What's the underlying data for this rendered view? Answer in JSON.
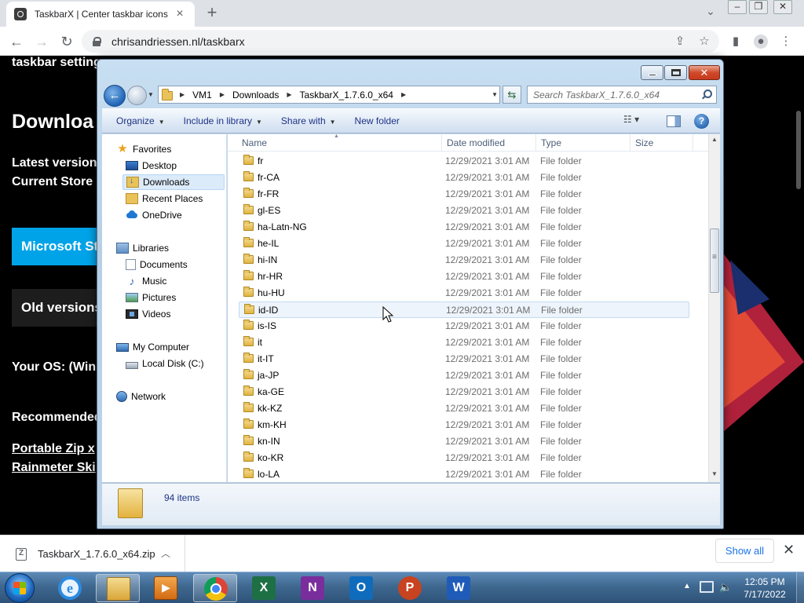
{
  "browser": {
    "tab_title": "TaskbarX | Center taskbar icons",
    "new_tab": "+",
    "url": "chrisandriessen.nl/taskbarx"
  },
  "webpage": {
    "line_top": "taskbar setting",
    "heading": "Downloa",
    "latest": "Latest version",
    "current": "Current Store ",
    "store_button": "Microsoft Sto",
    "old_button": "Old versions",
    "your_os": "Your OS: (Win",
    "recommended": "Recommended",
    "link1": "Portable Zip x",
    "link2": "Rainmeter Ski",
    "colors": {
      "store_button_bg": "#00a3e8",
      "old_button_bg": "#1d1d1d"
    }
  },
  "explorer": {
    "breadcrumbs": [
      "VM1",
      "Downloads",
      "TaskbarX_1.7.6.0_x64"
    ],
    "search_placeholder": "Search TaskbarX_1.7.6.0_x64",
    "toolbar": {
      "organize": "Organize",
      "include": "Include in library",
      "share": "Share with",
      "new_folder": "New folder"
    },
    "nav": {
      "favorites": "Favorites",
      "desktop": "Desktop",
      "downloads": "Downloads",
      "recent": "Recent Places",
      "onedrive": "OneDrive",
      "libraries": "Libraries",
      "documents": "Documents",
      "music": "Music",
      "pictures": "Pictures",
      "videos": "Videos",
      "computer": "My Computer",
      "local_disk": "Local Disk (C:)",
      "network": "Network"
    },
    "columns": {
      "name": "Name",
      "date": "Date modified",
      "type": "Type",
      "size": "Size"
    },
    "rows": [
      {
        "name": "fr",
        "date": "12/29/2021 3:01 AM",
        "type": "File folder"
      },
      {
        "name": "fr-CA",
        "date": "12/29/2021 3:01 AM",
        "type": "File folder"
      },
      {
        "name": "fr-FR",
        "date": "12/29/2021 3:01 AM",
        "type": "File folder"
      },
      {
        "name": "gl-ES",
        "date": "12/29/2021 3:01 AM",
        "type": "File folder"
      },
      {
        "name": "ha-Latn-NG",
        "date": "12/29/2021 3:01 AM",
        "type": "File folder"
      },
      {
        "name": "he-IL",
        "date": "12/29/2021 3:01 AM",
        "type": "File folder"
      },
      {
        "name": "hi-IN",
        "date": "12/29/2021 3:01 AM",
        "type": "File folder"
      },
      {
        "name": "hr-HR",
        "date": "12/29/2021 3:01 AM",
        "type": "File folder"
      },
      {
        "name": "hu-HU",
        "date": "12/29/2021 3:01 AM",
        "type": "File folder"
      },
      {
        "name": "id-ID",
        "date": "12/29/2021 3:01 AM",
        "type": "File folder"
      },
      {
        "name": "is-IS",
        "date": "12/29/2021 3:01 AM",
        "type": "File folder"
      },
      {
        "name": "it",
        "date": "12/29/2021 3:01 AM",
        "type": "File folder"
      },
      {
        "name": "it-IT",
        "date": "12/29/2021 3:01 AM",
        "type": "File folder"
      },
      {
        "name": "ja-JP",
        "date": "12/29/2021 3:01 AM",
        "type": "File folder"
      },
      {
        "name": "ka-GE",
        "date": "12/29/2021 3:01 AM",
        "type": "File folder"
      },
      {
        "name": "kk-KZ",
        "date": "12/29/2021 3:01 AM",
        "type": "File folder"
      },
      {
        "name": "km-KH",
        "date": "12/29/2021 3:01 AM",
        "type": "File folder"
      },
      {
        "name": "kn-IN",
        "date": "12/29/2021 3:01 AM",
        "type": "File folder"
      },
      {
        "name": "ko-KR",
        "date": "12/29/2021 3:01 AM",
        "type": "File folder"
      },
      {
        "name": "lo-LA",
        "date": "12/29/2021 3:01 AM",
        "type": "File folder"
      }
    ],
    "hover_row": "id-ID",
    "item_count": "94 items"
  },
  "download_shelf": {
    "file_name": "TaskbarX_1.7.6.0_x64.zip",
    "show_all": "Show all"
  },
  "taskbar": {
    "apps": [
      "internet-explorer-icon",
      "windows-explorer-icon",
      "media-center-icon",
      "chrome-icon",
      "excel-icon",
      "onenote-icon",
      "outlook-icon",
      "powerpoint-icon",
      "word-icon"
    ],
    "excel_letter": "X",
    "onenote_letter": "N",
    "outlook_letter": "O",
    "powerpoint_letter": "P",
    "word_letter": "W",
    "ie_letter": "e",
    "time": "12:05 PM",
    "date": "7/17/2022"
  }
}
